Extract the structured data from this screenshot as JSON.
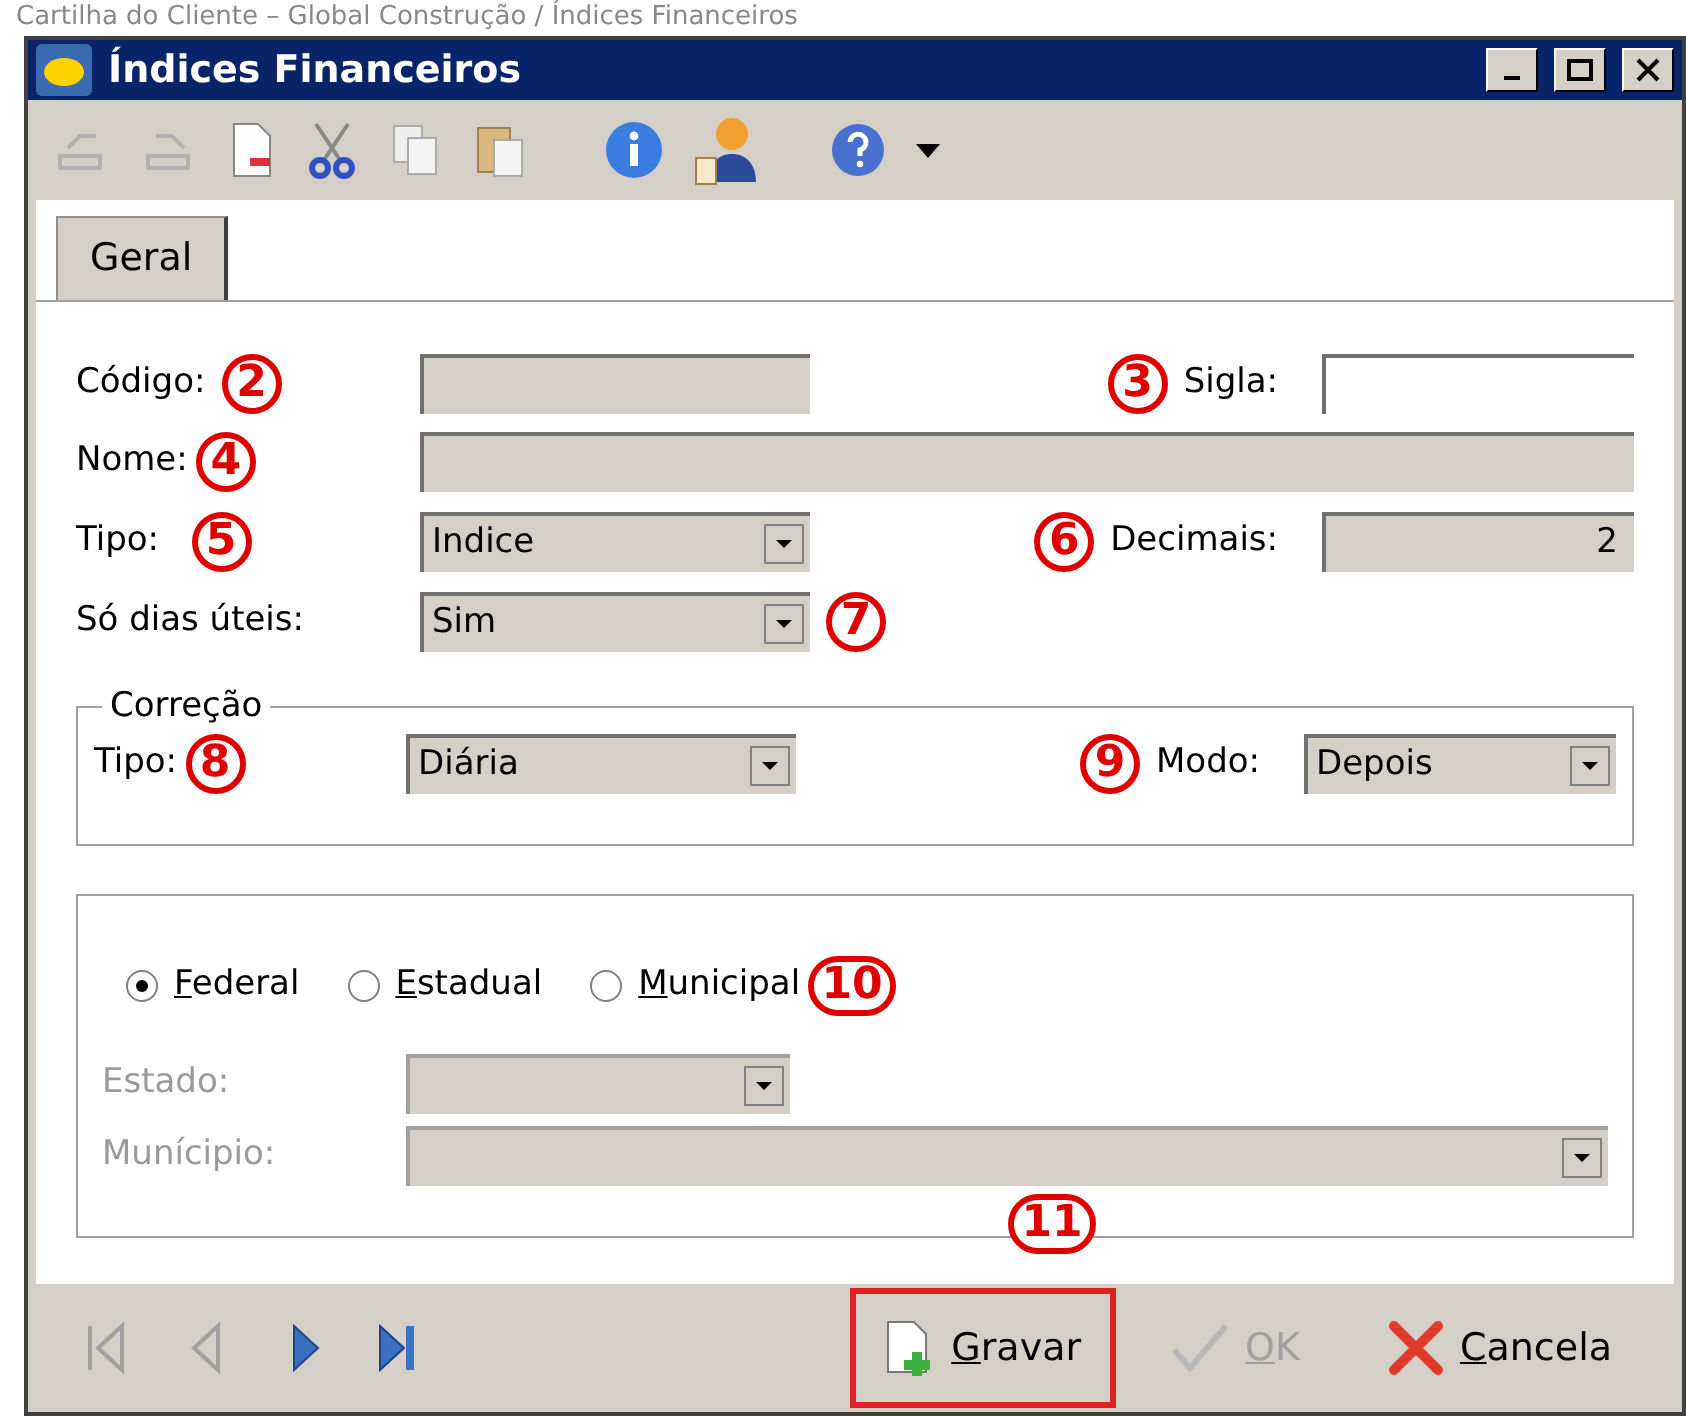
{
  "caption": "Cartilha do Cliente – Global Construção / Índices Financeiros",
  "window": {
    "title": "Índices Financeiros"
  },
  "tabs": [
    {
      "label": "Geral",
      "selected": true
    }
  ],
  "fields": {
    "codigo": {
      "label": "Código:",
      "callout": "2"
    },
    "sigla": {
      "label": "Sigla:",
      "callout": "3"
    },
    "nome": {
      "label": "Nome:",
      "callout": "4"
    },
    "tipo": {
      "label": "Tipo:",
      "callout": "5",
      "value": "Indice"
    },
    "decimais": {
      "label": "Decimais:",
      "callout": "6",
      "value": "2"
    },
    "dias_uteis": {
      "label": "Só dias úteis:",
      "callout": "7",
      "value": "Sim"
    }
  },
  "correcao": {
    "legend": "Correção",
    "tipo": {
      "label": "Tipo:",
      "callout": "8",
      "value": "Diária"
    },
    "modo": {
      "label": "Modo:",
      "callout": "9",
      "value": "Depois"
    }
  },
  "esfera": {
    "callout": "10",
    "options": [
      {
        "label": "Federal",
        "selected": true
      },
      {
        "label": "Estadual",
        "selected": false
      },
      {
        "label": "Municipal",
        "selected": false
      }
    ],
    "estado": {
      "label": "Estado:",
      "disabled": true
    },
    "municipio": {
      "label": "Munícipio:",
      "disabled": true
    }
  },
  "actions": {
    "callout": "11",
    "buttons": [
      {
        "kind": "save",
        "label": "Gravar",
        "disabled": false,
        "highlighted": true
      },
      {
        "kind": "ok",
        "label": "OK",
        "disabled": true,
        "highlighted": false
      },
      {
        "kind": "cancel",
        "label": "Cancela",
        "disabled": false,
        "highlighted": false
      }
    ]
  }
}
